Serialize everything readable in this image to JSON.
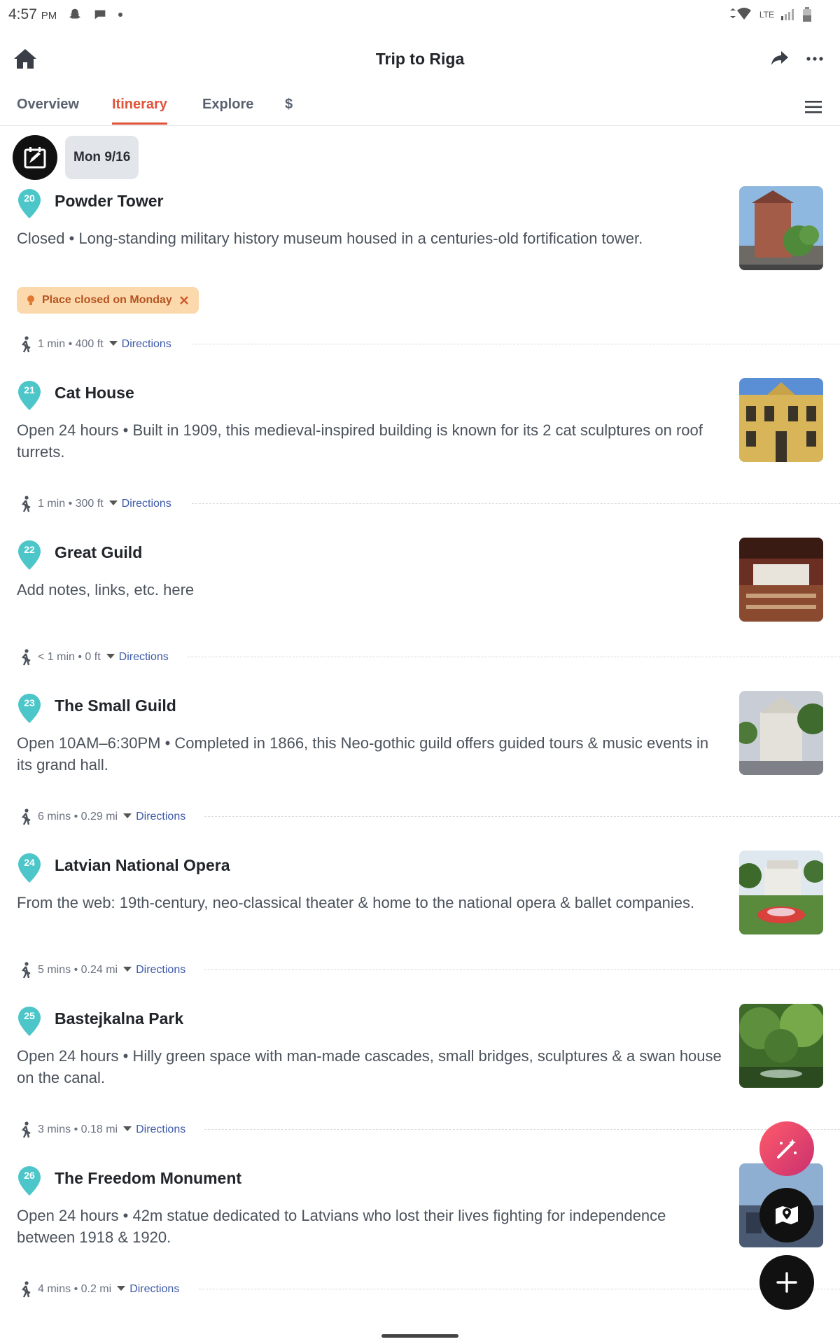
{
  "status_bar": {
    "time": "4:57",
    "ampm": "PM",
    "network": "LTE"
  },
  "header": {
    "title": "Trip to Riga"
  },
  "tabs": [
    {
      "label": "Overview"
    },
    {
      "label": "Itinerary"
    },
    {
      "label": "Explore"
    },
    {
      "label": "$"
    }
  ],
  "date_chip": "Mon 9/16",
  "closed_chip": "Place closed on Monday",
  "places": [
    {
      "number": "20",
      "name": "Powder Tower",
      "description": "Closed • Long-standing military history museum housed in a centuries-old fortification tower."
    },
    {
      "number": "21",
      "name": "Cat House",
      "description": "Open 24 hours • Built in 1909, this medieval-inspired building is known for its 2 cat sculptures on roof turrets."
    },
    {
      "number": "22",
      "name": "Great Guild",
      "description": "Add notes, links, etc. here"
    },
    {
      "number": "23",
      "name": "The Small Guild",
      "description": "Open 10AM–6:30PM • Completed in 1866, this Neo-gothic guild offers guided tours & music events in its grand hall."
    },
    {
      "number": "24",
      "name": "Latvian National Opera",
      "description": "From the web: 19th-century, neo-classical theater & home to the national opera & ballet companies."
    },
    {
      "number": "25",
      "name": "Bastejkalna Park",
      "description": "Open 24 hours • Hilly green space with man-made cascades, small bridges, sculptures & a swan house on the canal."
    },
    {
      "number": "26",
      "name": "The Freedom Monument",
      "description": "Open 24 hours • 42m statue dedicated to Latvians who lost their lives fighting for independence between 1918 & 1920."
    }
  ],
  "travel": [
    {
      "summary": "1 min • 400 ft",
      "link": "Directions"
    },
    {
      "summary": "1 min • 300 ft",
      "link": "Directions"
    },
    {
      "summary": "< 1 min • 0 ft",
      "link": "Directions"
    },
    {
      "summary": "6 mins • 0.29 mi",
      "link": "Directions"
    },
    {
      "summary": "5 mins • 0.24 mi",
      "link": "Directions"
    },
    {
      "summary": "3 mins • 0.18 mi",
      "link": "Directions"
    },
    {
      "summary": "4 mins • 0.2 mi",
      "link": "Directions"
    }
  ],
  "colors": {
    "accent": "#e0533a",
    "pin": "#4cc6c9",
    "link": "#3d5aa8",
    "chip_bg": "#fcd9ad",
    "chip_text": "#b5541f"
  },
  "icons": [
    "home-icon",
    "share-icon",
    "more-icon",
    "menu-icon",
    "calendar-icon",
    "pin-icon",
    "walk-icon",
    "magic-wand-icon",
    "map-icon",
    "add-icon",
    "close-icon",
    "lightbulb-icon"
  ]
}
